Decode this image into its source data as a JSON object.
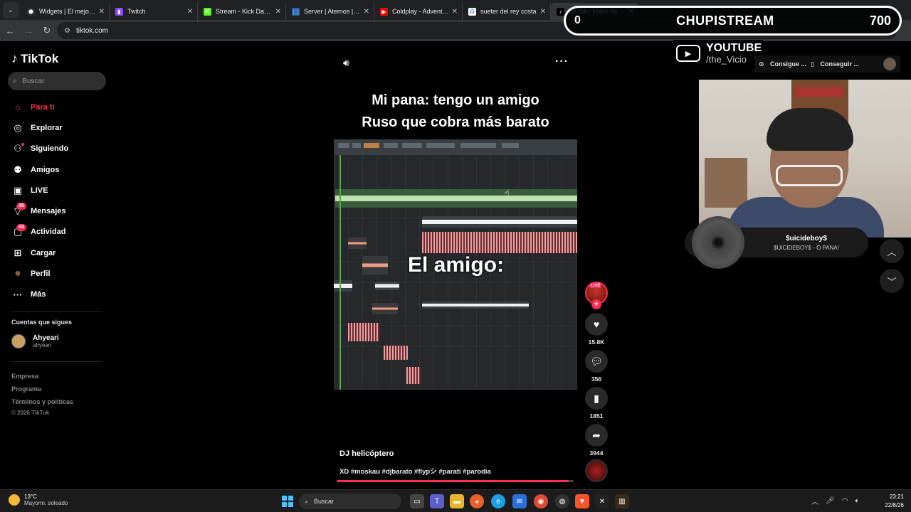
{
  "browser": {
    "tabs": [
      {
        "title": "Widgets | El mejor sc",
        "fav_color": "#2d2e31",
        "fav_glyph": "⬢"
      },
      {
        "title": "Twitch",
        "fav_color": "#9146ff",
        "fav_glyph": "▮"
      },
      {
        "title": "Stream - Kick Dashbo",
        "fav_color": "#53fc18",
        "fav_glyph": "K"
      },
      {
        "title": "Server | Aternos | Fre",
        "fav_color": "#2b6cb0",
        "fav_glyph": "⬚"
      },
      {
        "title": "Coldplay - Adventure",
        "fav_color": "#ff0000",
        "fav_glyph": "▶"
      },
      {
        "title": "sueter del rey costa",
        "fav_color": "#ffffff",
        "fav_glyph": "G"
      },
      {
        "title": "TikTok - Make Yo",
        "fav_color": "#000000",
        "fav_glyph": "♪"
      }
    ],
    "url": "tiktok.com"
  },
  "overlay": {
    "counter_left": "0",
    "counter_title": "CHUPISTREAM",
    "counter_right": "700",
    "yt_title": "YOUTUBE",
    "yt_handle": "/the_Vicio",
    "action1": "Consigue ...",
    "action2": "Conseguir ...",
    "music_title": "$uicideboy$",
    "music_sub": "$UICIDEBOY$ - O PANA!"
  },
  "sidebar": {
    "logo": "TikTok",
    "search_placeholder": "Buscar",
    "items": [
      {
        "label": "Para ti",
        "icon": "home-icon",
        "glyph": "⌂"
      },
      {
        "label": "Explorar",
        "icon": "compass-icon",
        "glyph": "◎"
      },
      {
        "label": "Siguiendo",
        "icon": "following-icon",
        "glyph": "⚇"
      },
      {
        "label": "Amigos",
        "icon": "friends-icon",
        "glyph": "⚉"
      },
      {
        "label": "LIVE",
        "icon": "live-icon",
        "glyph": "▣"
      },
      {
        "label": "Mensajes",
        "icon": "messages-icon",
        "glyph": "▽",
        "badge": "39"
      },
      {
        "label": "Actividad",
        "icon": "activity-icon",
        "glyph": "▢",
        "badge": "44"
      },
      {
        "label": "Cargar",
        "icon": "upload-icon",
        "glyph": "⊞"
      },
      {
        "label": "Perfil",
        "icon": "profile-avatar-icon",
        "glyph": "●"
      },
      {
        "label": "Más",
        "icon": "more-dots-icon",
        "glyph": "···"
      }
    ],
    "following_header": "Cuentas que sigues",
    "following": [
      {
        "name": "Ahyeari",
        "handle": "ahyeari"
      }
    ],
    "footer": [
      "Empresa",
      "Programa",
      "Términos y políticas"
    ],
    "copyright": "© 2026 TikTok"
  },
  "video": {
    "caption_line1": "Mi pana: tengo un amigo",
    "caption_line2": "Ruso que cobra más barato",
    "overlay_text": "El amigo:",
    "author": "DJ helicóptero",
    "tags": "XD #moskau #djbarato #flypシ #parati #parodia",
    "progress": 0.98,
    "live_tag": "LIVE",
    "likes": "15.8K",
    "comments": "356",
    "saves": "1851",
    "shares": "3944"
  },
  "taskbar": {
    "temp": "13°C",
    "weather": "Mayorm. soleado",
    "search": "Buscar",
    "time": "23:21",
    "date": "22/8/26"
  },
  "colors": {
    "accent": "#fe2c55",
    "bg": "#000000",
    "chrome": "#202124"
  }
}
